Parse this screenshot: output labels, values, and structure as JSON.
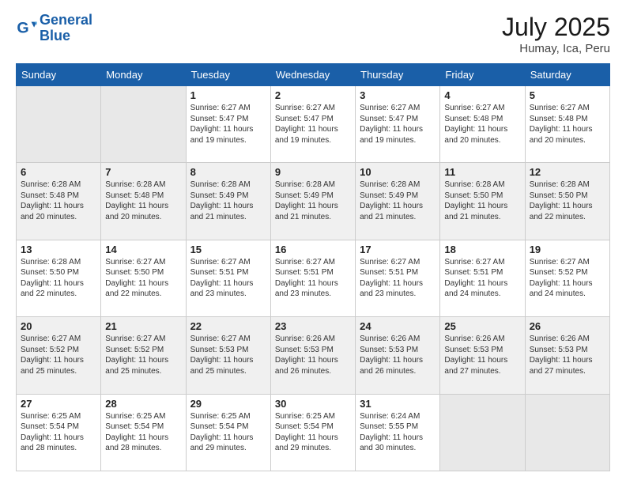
{
  "logo": {
    "line1": "General",
    "line2": "Blue"
  },
  "title": {
    "month_year": "July 2025",
    "location": "Humay, Ica, Peru"
  },
  "days_of_week": [
    "Sunday",
    "Monday",
    "Tuesday",
    "Wednesday",
    "Thursday",
    "Friday",
    "Saturday"
  ],
  "weeks": [
    [
      {
        "day": "",
        "info": ""
      },
      {
        "day": "",
        "info": ""
      },
      {
        "day": "1",
        "info": "Sunrise: 6:27 AM\nSunset: 5:47 PM\nDaylight: 11 hours and 19 minutes."
      },
      {
        "day": "2",
        "info": "Sunrise: 6:27 AM\nSunset: 5:47 PM\nDaylight: 11 hours and 19 minutes."
      },
      {
        "day": "3",
        "info": "Sunrise: 6:27 AM\nSunset: 5:47 PM\nDaylight: 11 hours and 19 minutes."
      },
      {
        "day": "4",
        "info": "Sunrise: 6:27 AM\nSunset: 5:48 PM\nDaylight: 11 hours and 20 minutes."
      },
      {
        "day": "5",
        "info": "Sunrise: 6:27 AM\nSunset: 5:48 PM\nDaylight: 11 hours and 20 minutes."
      }
    ],
    [
      {
        "day": "6",
        "info": "Sunrise: 6:28 AM\nSunset: 5:48 PM\nDaylight: 11 hours and 20 minutes."
      },
      {
        "day": "7",
        "info": "Sunrise: 6:28 AM\nSunset: 5:48 PM\nDaylight: 11 hours and 20 minutes."
      },
      {
        "day": "8",
        "info": "Sunrise: 6:28 AM\nSunset: 5:49 PM\nDaylight: 11 hours and 21 minutes."
      },
      {
        "day": "9",
        "info": "Sunrise: 6:28 AM\nSunset: 5:49 PM\nDaylight: 11 hours and 21 minutes."
      },
      {
        "day": "10",
        "info": "Sunrise: 6:28 AM\nSunset: 5:49 PM\nDaylight: 11 hours and 21 minutes."
      },
      {
        "day": "11",
        "info": "Sunrise: 6:28 AM\nSunset: 5:50 PM\nDaylight: 11 hours and 21 minutes."
      },
      {
        "day": "12",
        "info": "Sunrise: 6:28 AM\nSunset: 5:50 PM\nDaylight: 11 hours and 22 minutes."
      }
    ],
    [
      {
        "day": "13",
        "info": "Sunrise: 6:28 AM\nSunset: 5:50 PM\nDaylight: 11 hours and 22 minutes."
      },
      {
        "day": "14",
        "info": "Sunrise: 6:27 AM\nSunset: 5:50 PM\nDaylight: 11 hours and 22 minutes."
      },
      {
        "day": "15",
        "info": "Sunrise: 6:27 AM\nSunset: 5:51 PM\nDaylight: 11 hours and 23 minutes."
      },
      {
        "day": "16",
        "info": "Sunrise: 6:27 AM\nSunset: 5:51 PM\nDaylight: 11 hours and 23 minutes."
      },
      {
        "day": "17",
        "info": "Sunrise: 6:27 AM\nSunset: 5:51 PM\nDaylight: 11 hours and 23 minutes."
      },
      {
        "day": "18",
        "info": "Sunrise: 6:27 AM\nSunset: 5:51 PM\nDaylight: 11 hours and 24 minutes."
      },
      {
        "day": "19",
        "info": "Sunrise: 6:27 AM\nSunset: 5:52 PM\nDaylight: 11 hours and 24 minutes."
      }
    ],
    [
      {
        "day": "20",
        "info": "Sunrise: 6:27 AM\nSunset: 5:52 PM\nDaylight: 11 hours and 25 minutes."
      },
      {
        "day": "21",
        "info": "Sunrise: 6:27 AM\nSunset: 5:52 PM\nDaylight: 11 hours and 25 minutes."
      },
      {
        "day": "22",
        "info": "Sunrise: 6:27 AM\nSunset: 5:53 PM\nDaylight: 11 hours and 25 minutes."
      },
      {
        "day": "23",
        "info": "Sunrise: 6:26 AM\nSunset: 5:53 PM\nDaylight: 11 hours and 26 minutes."
      },
      {
        "day": "24",
        "info": "Sunrise: 6:26 AM\nSunset: 5:53 PM\nDaylight: 11 hours and 26 minutes."
      },
      {
        "day": "25",
        "info": "Sunrise: 6:26 AM\nSunset: 5:53 PM\nDaylight: 11 hours and 27 minutes."
      },
      {
        "day": "26",
        "info": "Sunrise: 6:26 AM\nSunset: 5:53 PM\nDaylight: 11 hours and 27 minutes."
      }
    ],
    [
      {
        "day": "27",
        "info": "Sunrise: 6:25 AM\nSunset: 5:54 PM\nDaylight: 11 hours and 28 minutes."
      },
      {
        "day": "28",
        "info": "Sunrise: 6:25 AM\nSunset: 5:54 PM\nDaylight: 11 hours and 28 minutes."
      },
      {
        "day": "29",
        "info": "Sunrise: 6:25 AM\nSunset: 5:54 PM\nDaylight: 11 hours and 29 minutes."
      },
      {
        "day": "30",
        "info": "Sunrise: 6:25 AM\nSunset: 5:54 PM\nDaylight: 11 hours and 29 minutes."
      },
      {
        "day": "31",
        "info": "Sunrise: 6:24 AM\nSunset: 5:55 PM\nDaylight: 11 hours and 30 minutes."
      },
      {
        "day": "",
        "info": ""
      },
      {
        "day": "",
        "info": ""
      }
    ]
  ]
}
